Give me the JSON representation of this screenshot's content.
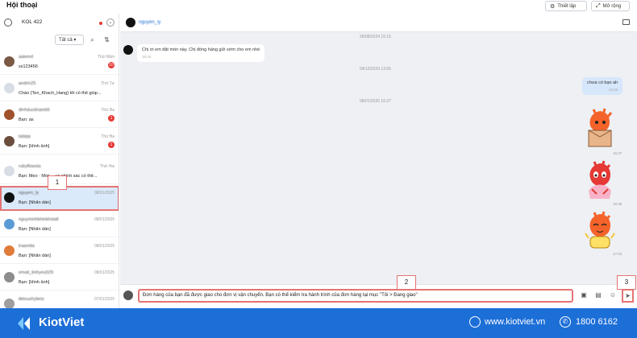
{
  "header": {
    "title": "Hội thoại",
    "settings_label": "Thiết lập",
    "expand_label": "Mở rộng"
  },
  "account": {
    "name": "KOL 422"
  },
  "filter": {
    "selected": "Tất cả"
  },
  "conversations": [
    {
      "name": "aakend",
      "preview": "ss123456",
      "time": "Thứ Năm",
      "badge": "10"
    },
    {
      "name": "andrin25",
      "preview": "Chào {Ten_Khach_Hang} tôi có thể giúp...",
      "time": "Thứ Tư",
      "badge": ""
    },
    {
      "name": "dinhduckhamb5",
      "preview": "Bạn: as",
      "time": "Thứ Ba",
      "badge": "1"
    },
    {
      "name": "tabipp",
      "preview": "Bạn: [Hình ảnh]",
      "time": "Thứ Ba",
      "badge": "1"
    },
    {
      "name": "rubyflowsla",
      "preview": "Bạn: Mẹo · Mời ... ục chính sác có thể...",
      "time": "Thứ Hai",
      "badge": ""
    },
    {
      "name": "nguyen_ly",
      "preview": "Bạn: [Nhãn dán]",
      "time": "08/01/2025",
      "badge": ""
    },
    {
      "name": "nguyminhkhinkhstall",
      "preview": "Bạn: [Nhãn dán]",
      "time": "08/01/2025",
      "badge": ""
    },
    {
      "name": "traamita",
      "preview": "Bạn: [Nhãn dán]",
      "time": "08/01/2025",
      "badge": ""
    },
    {
      "name": "email_tinhyeu029",
      "preview": "Bạn: [Hình ảnh]",
      "time": "08/01/2025",
      "badge": ""
    },
    {
      "name": "tiktoushybeiz",
      "preview": "",
      "time": "07/01/2025",
      "badge": ""
    }
  ],
  "chat": {
    "contact": "nguyen_ly",
    "date1": "28/08/2024 15:15",
    "msg_in": "Chị ơi em đặt món này. Chị đóng hàng gửi sớm cho em nhé",
    "msg_in_time": "15:15",
    "date2": "04/12/2024 13:55",
    "msg_out": "chưa có bạn ah",
    "msg_out_time": "13:55",
    "date3": "08/01/2025 16:37",
    "sticker_times": [
      "16:37",
      "16:38",
      "17:02"
    ],
    "composer_text": "Đơn hàng của bạn đã được giao cho đơn vị vận chuyển. Bạn có thể kiểm tra hành trình của đơn hàng tại mục \"Tôi > Đang giao\""
  },
  "callouts": [
    "1",
    "2",
    "3"
  ],
  "footer": {
    "brand": "KiotViet",
    "website": "www.kiotviet.vn",
    "phone": "1800 6162"
  },
  "colors": {
    "brand_blue": "#1d6fd8",
    "highlight_red": "#e57373",
    "active_row": "#dbeafa",
    "badge_red": "#e53935"
  }
}
